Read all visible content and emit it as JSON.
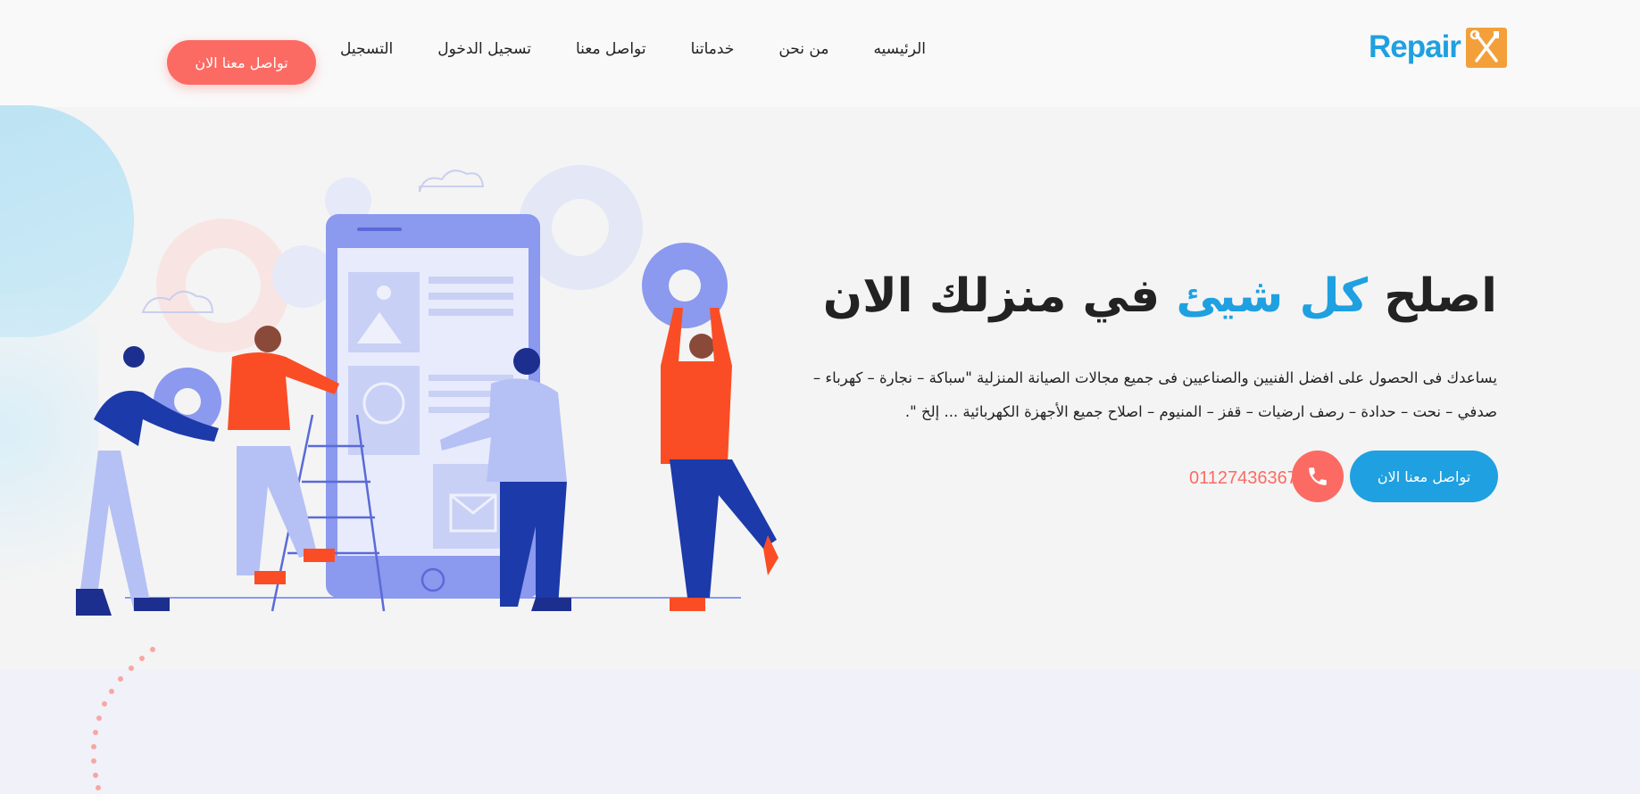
{
  "brand": {
    "name": "Repair",
    "accent": "#1fa0e0",
    "logo_color": "#f3a03a"
  },
  "nav": {
    "items": [
      {
        "label": "الرئيسيه"
      },
      {
        "label": "من نحن"
      },
      {
        "label": "خدماتنا"
      },
      {
        "label": "تواصل معنا"
      },
      {
        "label": "تسجيل الدخول"
      },
      {
        "label": "التسجيل"
      }
    ],
    "cta_label": "تواصل معنا الان"
  },
  "hero": {
    "title_part1": "اصلح",
    "title_highlight": "كل شيئ",
    "title_part2": "في منزلك الان",
    "description": "يساعدك فى الحصول على افضل الفنيين والصناعيين فى جميع مجالات الصيانة المنزلية \"سباكة – نجارة – كهرباء – صدفي – نحت – حدادة – رصف ارضيات – قفز – المنيوم – اصلاح جميع الأجهزة الكهربائية ... إلخ \".",
    "cta_label": "تواصل معنا الان",
    "phone": "01127436367",
    "phone_icon": "phone-icon"
  },
  "colors": {
    "primary": "#1fa0e0",
    "secondary": "#fb6b63",
    "dark": "#222222"
  }
}
